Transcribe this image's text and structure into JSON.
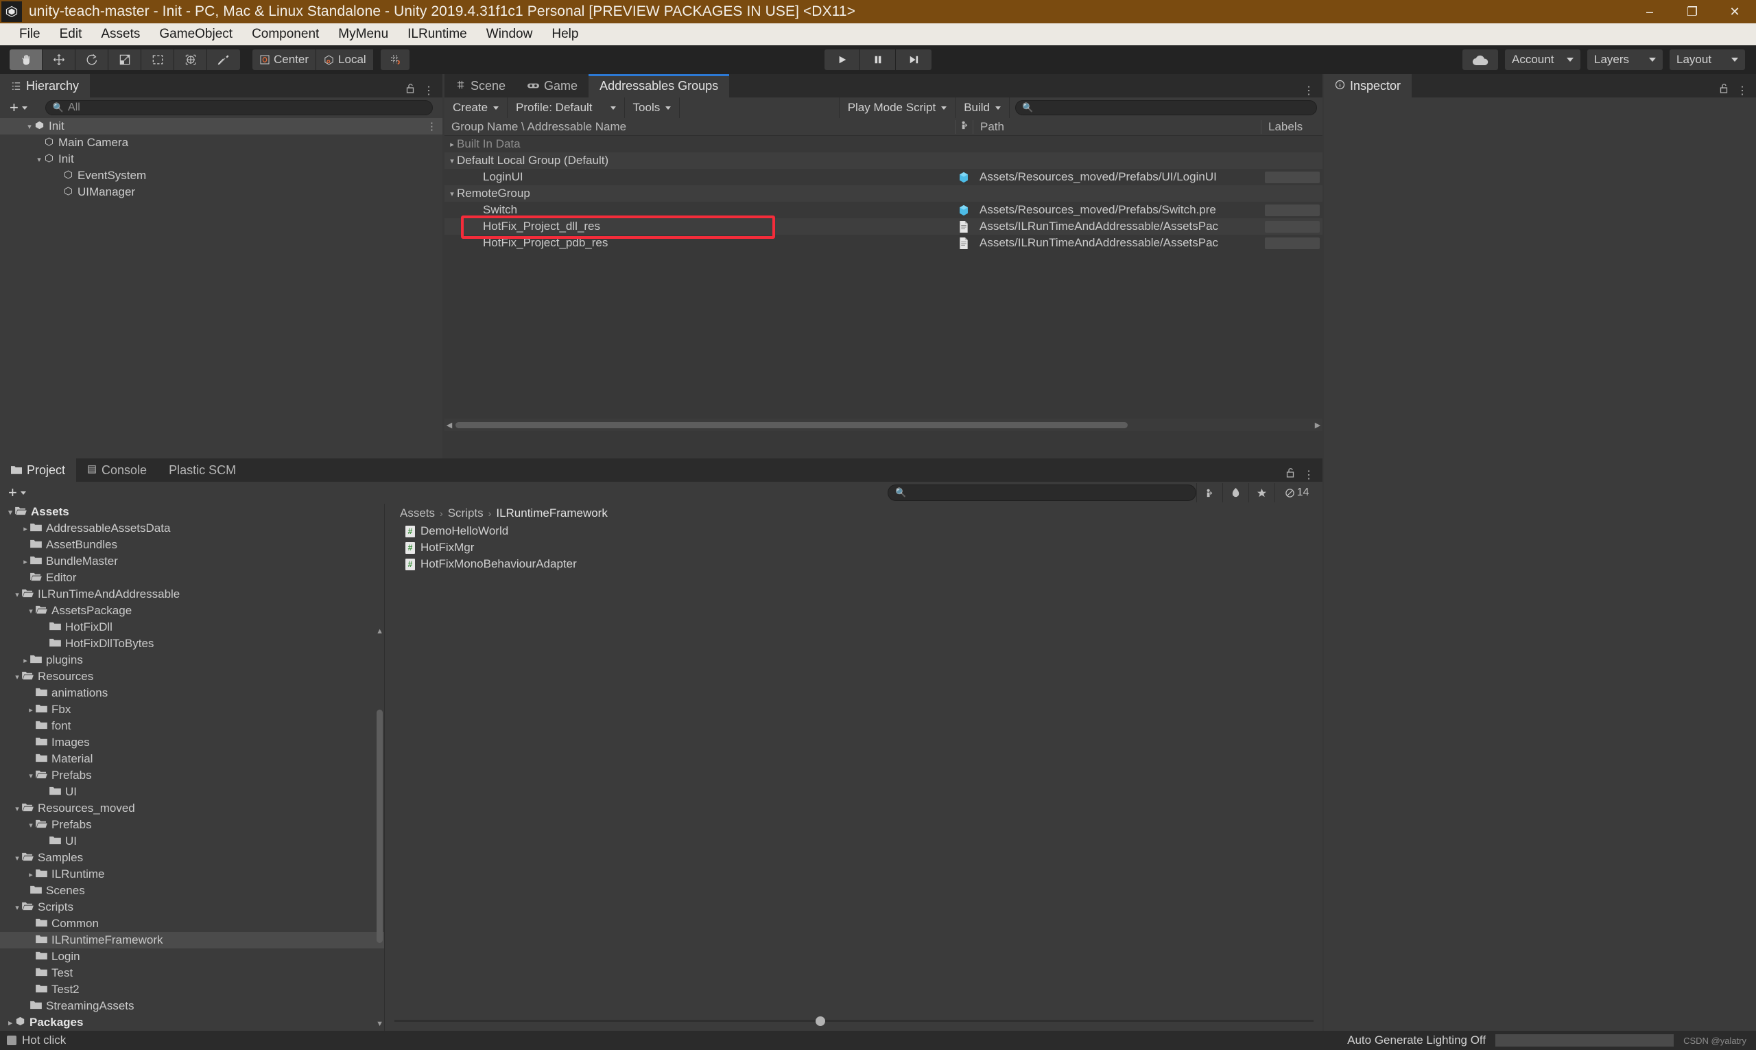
{
  "window": {
    "title": "unity-teach-master - Init - PC, Mac & Linux Standalone - Unity 2019.4.31f1c1 Personal [PREVIEW PACKAGES IN USE] <DX11>",
    "minimize": "–",
    "maximize": "❐",
    "close": "✕",
    "app_icon": "unity-logo-icon"
  },
  "menubar": {
    "items": [
      "File",
      "Edit",
      "Assets",
      "GameObject",
      "Component",
      "MyMenu",
      "ILRuntime",
      "Window",
      "Help"
    ]
  },
  "toolbar": {
    "tools": [
      "hand-tool",
      "move-tool",
      "rotate-tool",
      "scale-tool",
      "rect-tool",
      "transform-tool",
      "custom-tool"
    ],
    "pivot_label": "Center",
    "handle_label": "Local",
    "grid_label": "grid-snapping-icon",
    "play": "▶",
    "pause": "❙❙",
    "step": "▶❘",
    "cloud_label": "cloud-icon",
    "account_label": "Account",
    "layers_label": "Layers",
    "layout_label": "Layout"
  },
  "hierarchy": {
    "tab_label": "Hierarchy",
    "tab_icon": "hierarchy-icon",
    "lock_icon": "🔓",
    "kebab_icon": "⋮",
    "add_label": "+",
    "search_placeholder": "All",
    "rows": [
      {
        "label": "Init",
        "indent": 1,
        "tri": "▾",
        "icon": "unity-scene-icon",
        "selected": true,
        "kebab": true
      },
      {
        "label": "Main Camera",
        "indent": 2,
        "tri": "",
        "icon": "gameobject-icon",
        "selected": false,
        "kebab": false
      },
      {
        "label": "Init",
        "indent": 2,
        "tri": "▾",
        "icon": "gameobject-icon",
        "selected": false,
        "kebab": false
      },
      {
        "label": "EventSystem",
        "indent": 3,
        "tri": "",
        "icon": "gameobject-icon",
        "selected": false,
        "kebab": false
      },
      {
        "label": "UIManager",
        "indent": 3,
        "tri": "",
        "icon": "gameobject-icon",
        "selected": false,
        "kebab": false
      }
    ]
  },
  "center": {
    "tabs": [
      {
        "label": "Scene",
        "icon": "scene-icon",
        "active": false
      },
      {
        "label": "Game",
        "icon": "game-icon",
        "active": false
      },
      {
        "label": "Addressables Groups",
        "icon": "",
        "active": true
      }
    ],
    "kebab_icon": "⋮",
    "toolbar": {
      "create_label": "Create",
      "profile_label": "Profile: Default",
      "tools_label": "Tools",
      "play_mode_label": "Play Mode Script",
      "build_label": "Build",
      "search_placeholder": ""
    },
    "columns": {
      "name": "Group Name \\ Addressable Name",
      "icon": "asset-type-icon",
      "path": "Path",
      "labels": "Labels"
    },
    "rows": [
      {
        "label": "Built In Data",
        "indent": 0,
        "tri": "▸",
        "dim": true,
        "icon": "",
        "path": "",
        "labels": false,
        "alt": false
      },
      {
        "label": "Default Local Group (Default)",
        "indent": 0,
        "tri": "▾",
        "dim": false,
        "icon": "",
        "path": "",
        "labels": false,
        "alt": true
      },
      {
        "label": "LoginUI",
        "indent": 2,
        "tri": "",
        "dim": false,
        "icon": "prefab-icon",
        "path": "Assets/Resources_moved/Prefabs/UI/LoginUI",
        "labels": true,
        "alt": false
      },
      {
        "label": "RemoteGroup",
        "indent": 0,
        "tri": "▾",
        "dim": false,
        "icon": "",
        "path": "",
        "labels": false,
        "alt": true
      },
      {
        "label": "Switch",
        "indent": 2,
        "tri": "",
        "dim": false,
        "icon": "prefab-icon",
        "path": "Assets/Resources_moved/Prefabs/Switch.pre",
        "labels": true,
        "alt": false
      },
      {
        "label": "HotFix_Project_dll_res",
        "indent": 2,
        "tri": "",
        "dim": false,
        "icon": "text-asset-icon",
        "path": "Assets/ILRunTimeAndAddressable/AssetsPac",
        "labels": true,
        "alt": true
      },
      {
        "label": "HotFix_Project_pdb_res",
        "indent": 2,
        "tri": "",
        "dim": false,
        "icon": "text-asset-icon",
        "path": "Assets/ILRunTimeAndAddressable/AssetsPac",
        "labels": true,
        "alt": false
      }
    ],
    "highlight_color": "#f42c3a"
  },
  "inspector": {
    "tab_label": "Inspector",
    "tab_icon": "info-icon",
    "lock_icon": "🔓",
    "kebab_icon": "⋮"
  },
  "project": {
    "tabs": [
      {
        "label": "Project",
        "icon": "folder-icon",
        "active": true
      },
      {
        "label": "Console",
        "icon": "console-icon",
        "active": false
      },
      {
        "label": "Plastic SCM",
        "icon": "",
        "active": false
      }
    ],
    "lock_icon": "🔓",
    "kebab_icon": "⋮",
    "add_label": "+",
    "search_placeholder": "",
    "filter_icons": [
      "search-by-type-icon",
      "search-by-label-icon",
      "favorites-star-icon"
    ],
    "hidden_count_icon": "hidden-packages-icon",
    "hidden_count": "14",
    "tree": [
      {
        "label": "Assets",
        "indent": 0,
        "tri": "▾",
        "open": true,
        "bold": true,
        "selected": false
      },
      {
        "label": "AddressableAssetsData",
        "indent": 1,
        "tri": "▸",
        "open": false,
        "bold": false,
        "selected": false
      },
      {
        "label": "AssetBundles",
        "indent": 1,
        "tri": "",
        "open": false,
        "bold": false,
        "selected": false
      },
      {
        "label": "BundleMaster",
        "indent": 1,
        "tri": "▸",
        "open": false,
        "bold": false,
        "selected": false
      },
      {
        "label": "Editor",
        "indent": 1,
        "tri": "",
        "open": true,
        "bold": false,
        "selected": false
      },
      {
        "label": "ILRunTimeAndAddressable",
        "indent": 1,
        "tri": "▾",
        "open": true,
        "bold": false,
        "selected": false
      },
      {
        "label": "AssetsPackage",
        "indent": 2,
        "tri": "▾",
        "open": true,
        "bold": false,
        "selected": false
      },
      {
        "label": "HotFixDll",
        "indent": 3,
        "tri": "",
        "open": false,
        "bold": false,
        "selected": false
      },
      {
        "label": "HotFixDllToBytes",
        "indent": 3,
        "tri": "",
        "open": false,
        "bold": false,
        "selected": false
      },
      {
        "label": "plugins",
        "indent": 1,
        "tri": "▸",
        "open": false,
        "bold": false,
        "selected": false
      },
      {
        "label": "Resources",
        "indent": 1,
        "tri": "▾",
        "open": true,
        "bold": false,
        "selected": false
      },
      {
        "label": "animations",
        "indent": 2,
        "tri": "",
        "open": false,
        "bold": false,
        "selected": false
      },
      {
        "label": "Fbx",
        "indent": 2,
        "tri": "▸",
        "open": false,
        "bold": false,
        "selected": false
      },
      {
        "label": "font",
        "indent": 2,
        "tri": "",
        "open": false,
        "bold": false,
        "selected": false
      },
      {
        "label": "Images",
        "indent": 2,
        "tri": "",
        "open": false,
        "bold": false,
        "selected": false
      },
      {
        "label": "Material",
        "indent": 2,
        "tri": "",
        "open": false,
        "bold": false,
        "selected": false
      },
      {
        "label": "Prefabs",
        "indent": 2,
        "tri": "▾",
        "open": true,
        "bold": false,
        "selected": false
      },
      {
        "label": "UI",
        "indent": 3,
        "tri": "",
        "open": false,
        "bold": false,
        "selected": false
      },
      {
        "label": "Resources_moved",
        "indent": 1,
        "tri": "▾",
        "open": true,
        "bold": false,
        "selected": false
      },
      {
        "label": "Prefabs",
        "indent": 2,
        "tri": "▾",
        "open": true,
        "bold": false,
        "selected": false
      },
      {
        "label": "UI",
        "indent": 3,
        "tri": "",
        "open": false,
        "bold": false,
        "selected": false
      },
      {
        "label": "Samples",
        "indent": 1,
        "tri": "▾",
        "open": true,
        "bold": false,
        "selected": false
      },
      {
        "label": "ILRuntime",
        "indent": 2,
        "tri": "▸",
        "open": false,
        "bold": false,
        "selected": false
      },
      {
        "label": "Scenes",
        "indent": 1,
        "tri": "",
        "open": false,
        "bold": false,
        "selected": false
      },
      {
        "label": "Scripts",
        "indent": 1,
        "tri": "▾",
        "open": true,
        "bold": false,
        "selected": false
      },
      {
        "label": "Common",
        "indent": 2,
        "tri": "",
        "open": false,
        "bold": false,
        "selected": false
      },
      {
        "label": "ILRuntimeFramework",
        "indent": 2,
        "tri": "",
        "open": false,
        "bold": false,
        "selected": true
      },
      {
        "label": "Login",
        "indent": 2,
        "tri": "",
        "open": false,
        "bold": false,
        "selected": false
      },
      {
        "label": "Test",
        "indent": 2,
        "tri": "",
        "open": false,
        "bold": false,
        "selected": false
      },
      {
        "label": "Test2",
        "indent": 2,
        "tri": "",
        "open": false,
        "bold": false,
        "selected": false
      },
      {
        "label": "StreamingAssets",
        "indent": 1,
        "tri": "",
        "open": false,
        "bold": false,
        "selected": false
      },
      {
        "label": "Packages",
        "indent": 0,
        "tri": "▸",
        "open": false,
        "bold": true,
        "selected": false
      }
    ],
    "breadcrumb": [
      "Assets",
      "Scripts",
      "ILRuntimeFramework"
    ],
    "files": [
      {
        "label": "DemoHelloWorld",
        "icon": "cs-script-icon"
      },
      {
        "label": "HotFixMgr",
        "icon": "cs-script-icon"
      },
      {
        "label": "HotFixMonoBehaviourAdapter",
        "icon": "cs-script-icon"
      }
    ]
  },
  "statusbar": {
    "message": "Hot click",
    "message_icon": "log-icon",
    "lighting_label": "Auto Generate Lighting Off",
    "watermark": "CSDN @yalatry"
  }
}
